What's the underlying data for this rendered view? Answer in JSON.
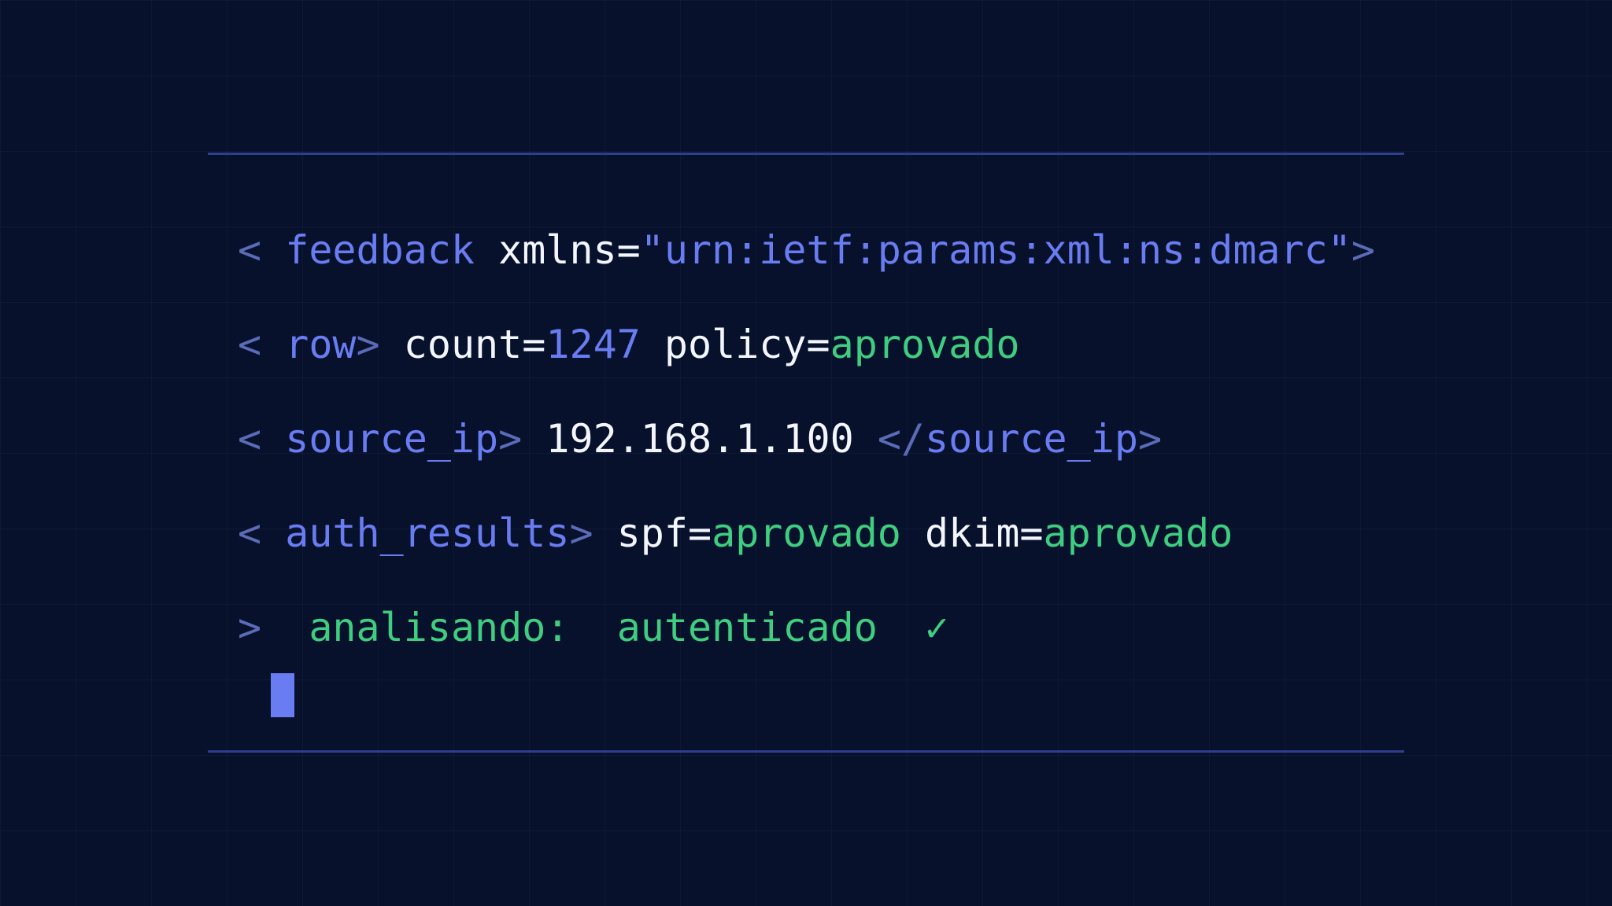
{
  "colors": {
    "background": "#07112c",
    "rule": "#2e3d8c",
    "tag": "#6a7cf2",
    "punctuation": "#5b6bb7",
    "text": "#f4f6ff",
    "success": "#3fcd7f"
  },
  "lines": [
    {
      "open": "< ",
      "tag": "feedback",
      "attr": " xmlns=",
      "value": "\"urn:ietf:params:xml:ns:dmarc\"",
      "close": ">"
    },
    {
      "open": "< ",
      "tag": "row",
      "close": ">",
      "count_key": " count=",
      "count_value": "1247",
      "policy_key": " policy=",
      "policy_value": "aprovado"
    },
    {
      "open": "< ",
      "tag": "source_ip",
      "close": ">",
      "value": " 192.168.1.100 ",
      "end_open": "</",
      "end_tag": "source_ip",
      "end_close": ">"
    },
    {
      "open": "< ",
      "tag": "auth_results",
      "close": ">",
      "spf_key": " spf=",
      "spf_value": "aprovado",
      "dkim_key": " dkim=",
      "dkim_value": "aprovado"
    }
  ],
  "status": {
    "prompt": ">",
    "label": "analisando:",
    "result": "autenticado",
    "check": "✓"
  }
}
